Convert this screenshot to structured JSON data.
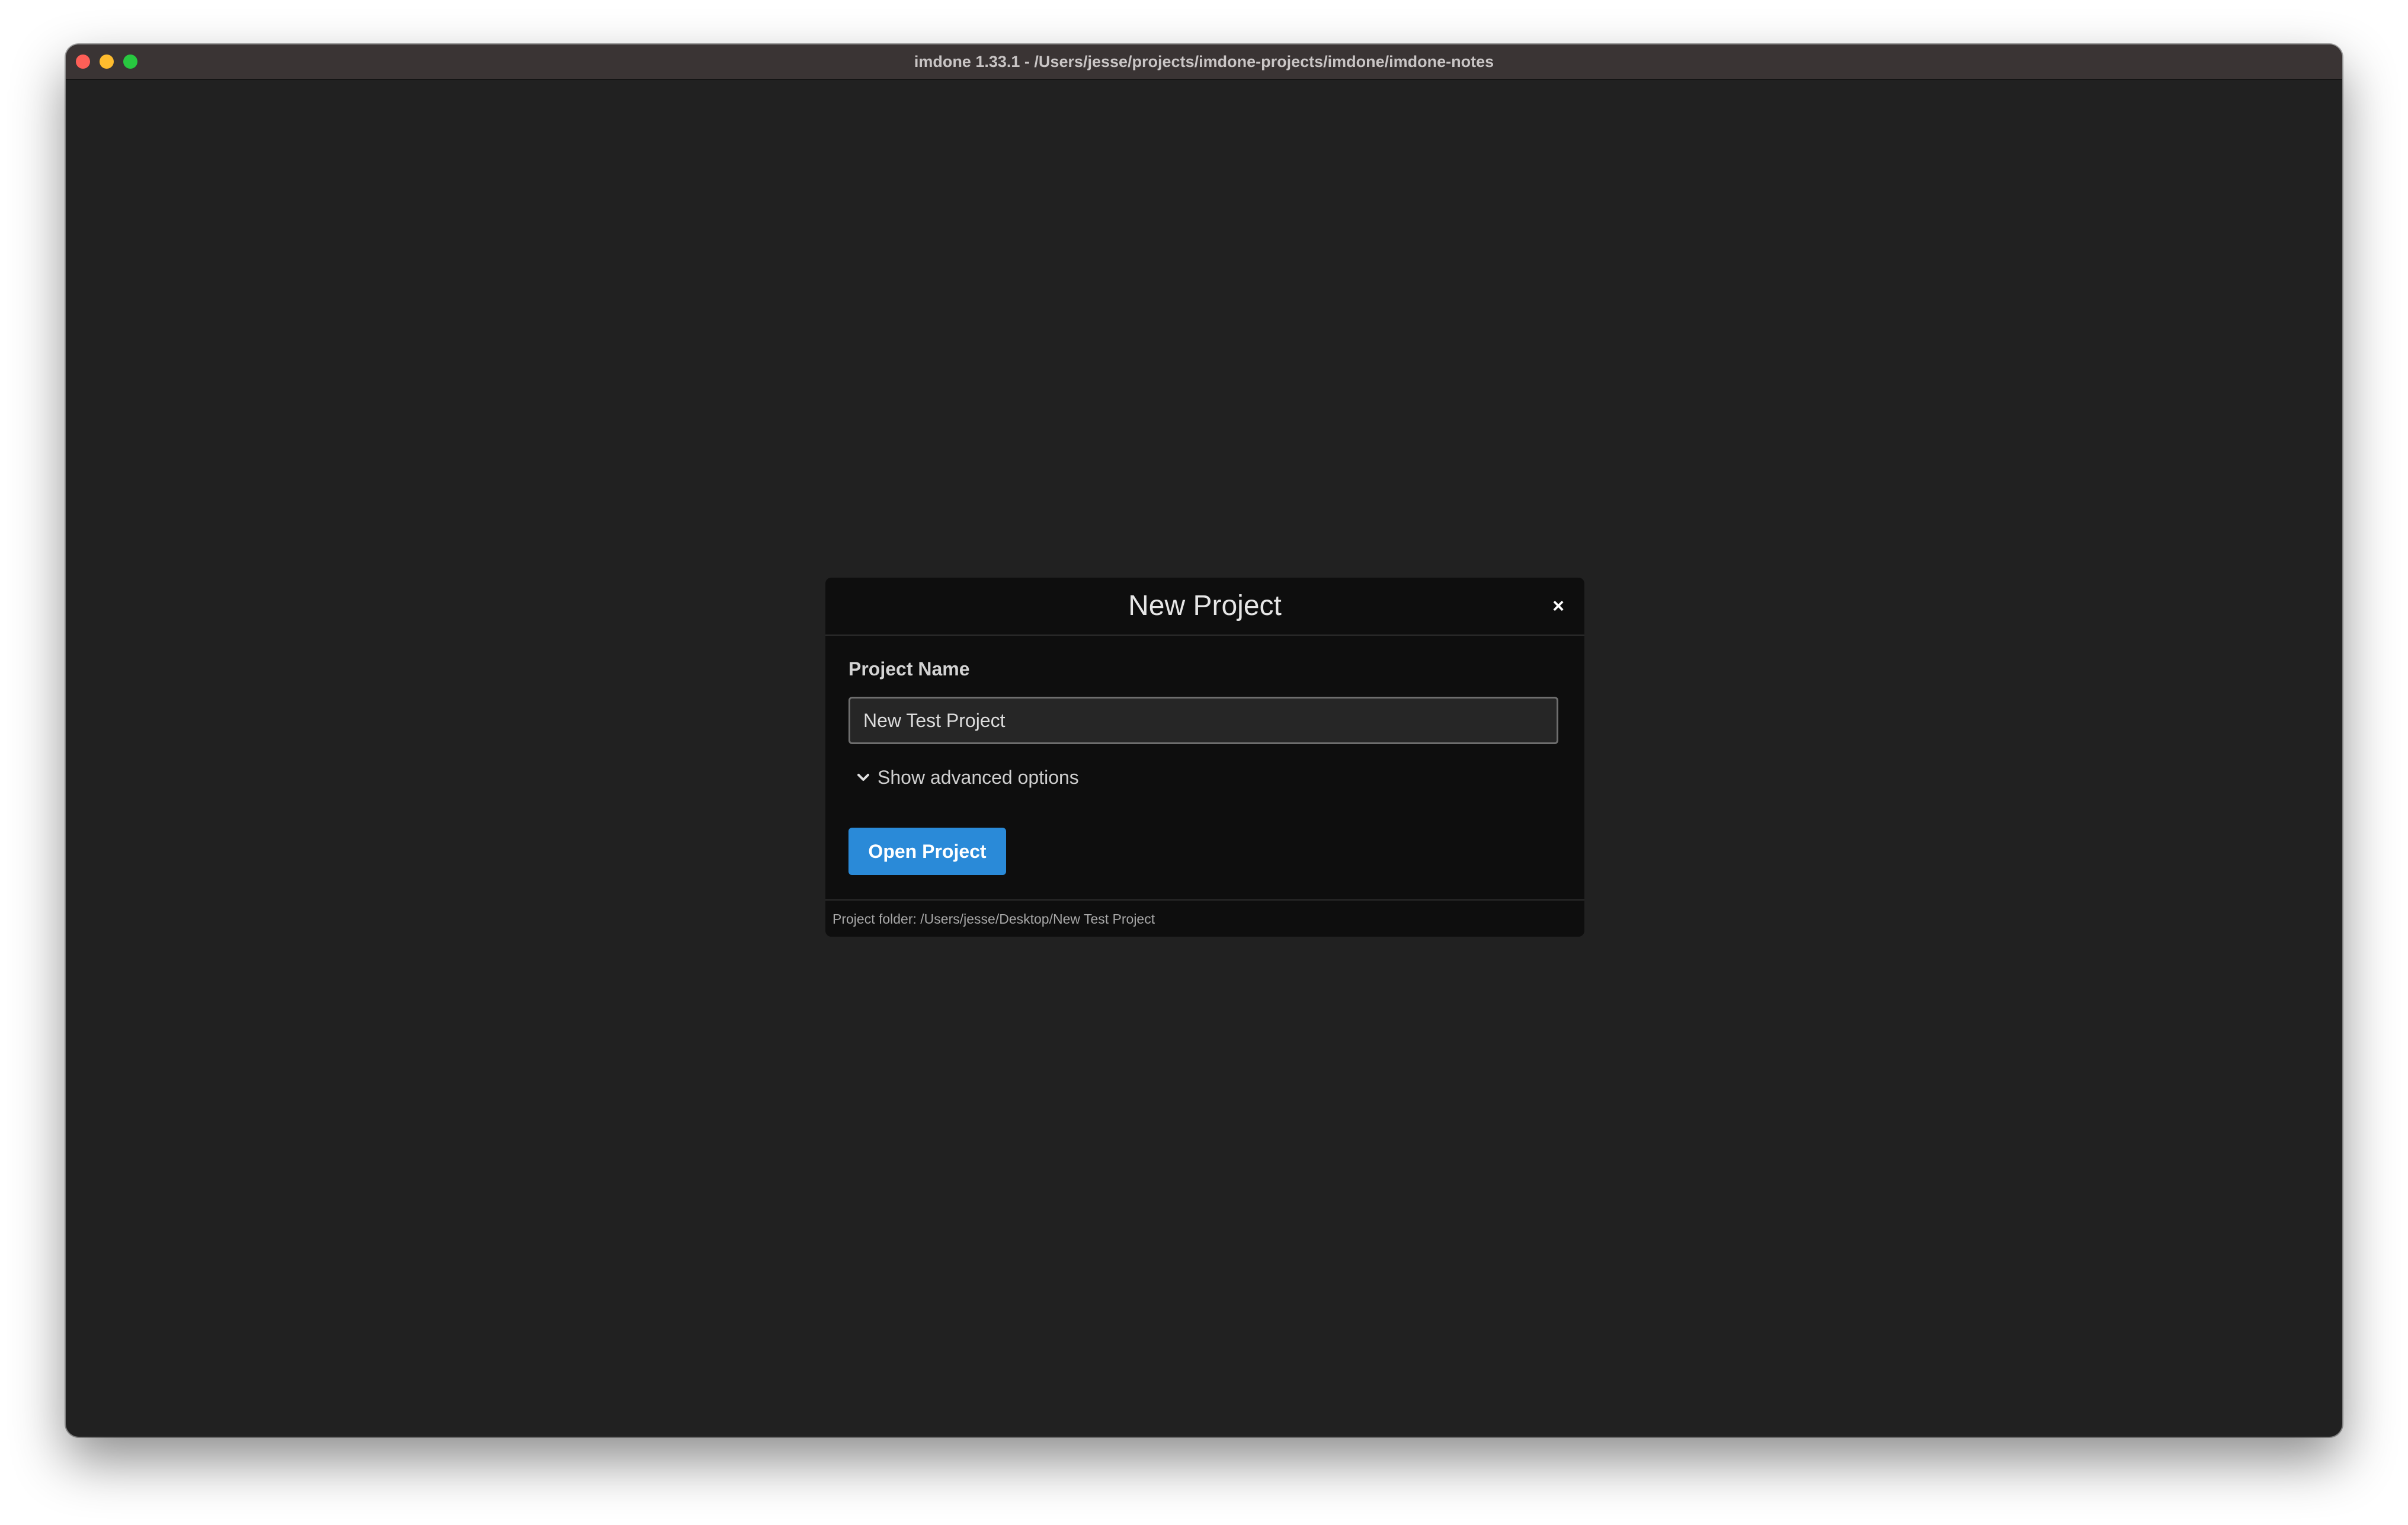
{
  "window": {
    "title": "imdone 1.33.1 - /Users/jesse/projects/imdone-projects/imdone/imdone-notes"
  },
  "modal": {
    "title": "New Project",
    "close_label": "×",
    "project_name_label": "Project Name",
    "project_name_value": "New Test Project",
    "advanced_toggle_label": "Show advanced options",
    "open_button_label": "Open Project",
    "footer_text": "Project folder: /Users/jesse/Desktop/New Test Project"
  },
  "colors": {
    "background": "#212121",
    "modal_background": "#0e0e0e",
    "accent_button": "#2a8ad8",
    "traffic_close": "#fe5f57",
    "traffic_minimize": "#febc2e",
    "traffic_maximize": "#28c840"
  },
  "icons": {
    "close": "close-icon",
    "advanced_toggle": "chevron-down-icon"
  }
}
